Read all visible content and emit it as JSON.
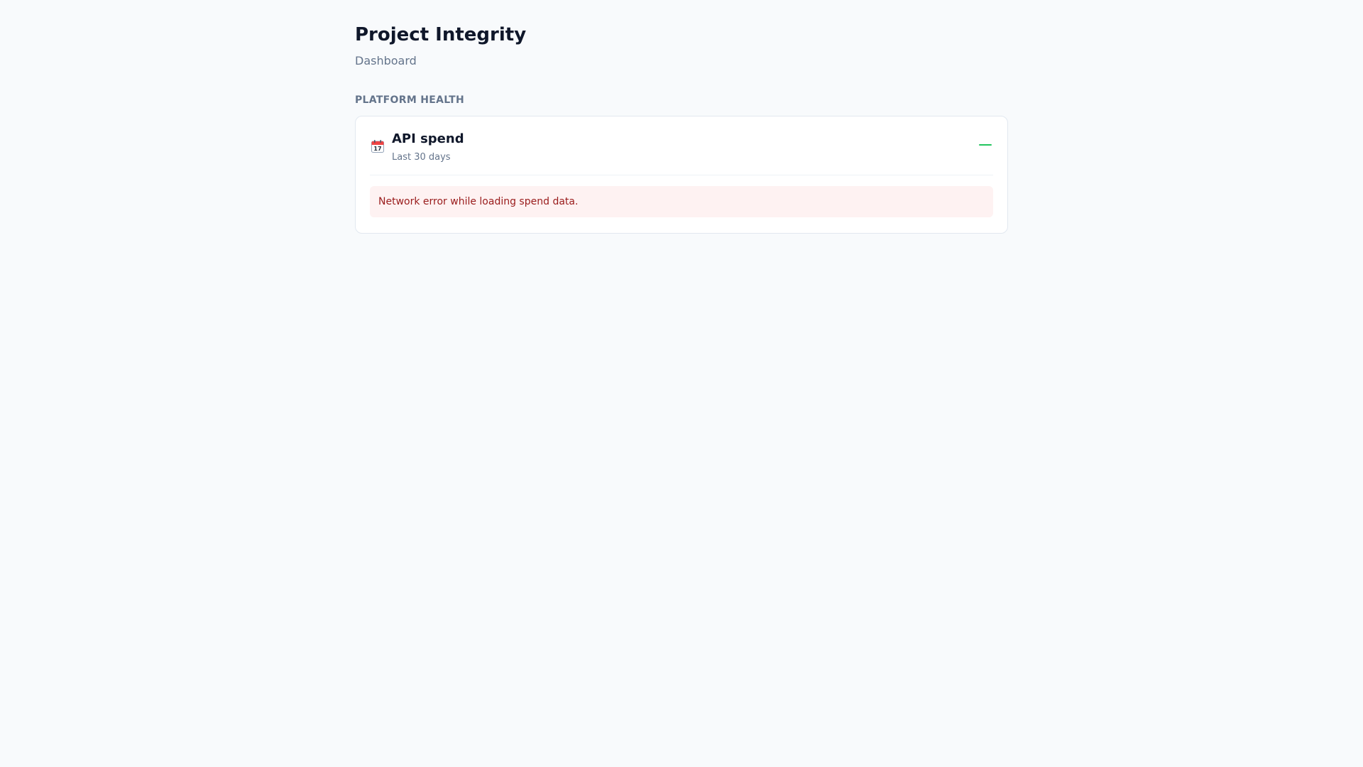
{
  "header": {
    "title": "Project Integrity",
    "subtitle": "Dashboard"
  },
  "section": {
    "heading": "PLATFORM HEALTH"
  },
  "api_spend_card": {
    "icon": "calendar-icon",
    "title": "API spend",
    "caption": "Last 30 days",
    "status_color": "#22c55e",
    "error_message": "Network error while loading spend data."
  },
  "colors": {
    "background": "#f8fafc",
    "error_background": "#fef2f2",
    "error_text": "#991b1b"
  }
}
